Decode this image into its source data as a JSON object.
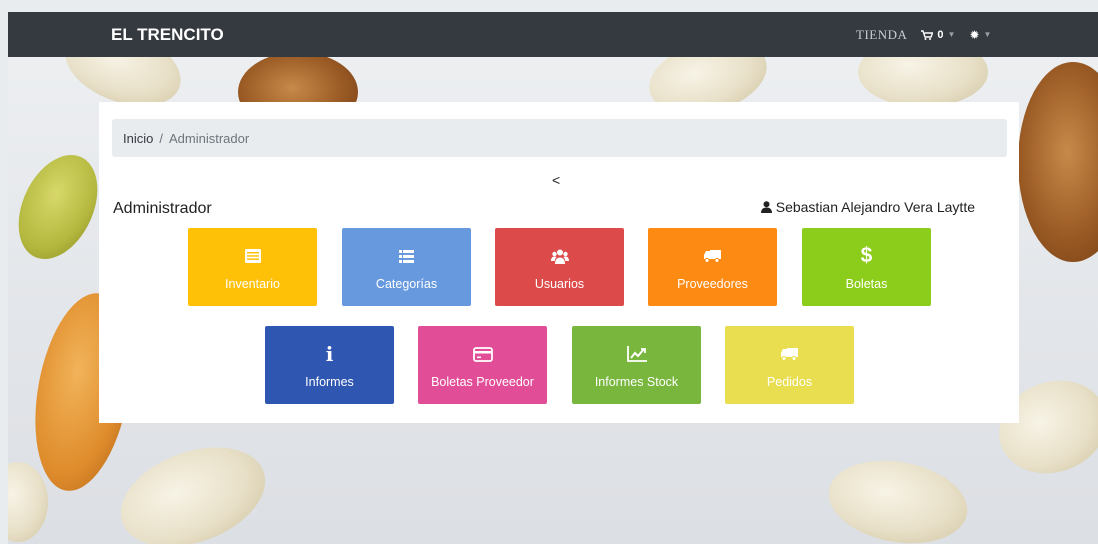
{
  "navbar": {
    "brand": "EL TRENCITO",
    "tienda": "TIENDA",
    "cart_count": "0"
  },
  "breadcrumb": {
    "home": "Inicio",
    "separator": "/",
    "current": "Administrador"
  },
  "back_symbol": "<",
  "page_title": "Administrador",
  "user_name": "Sebastian Alejandro Vera Laytte",
  "tiles": [
    {
      "label": "Inventario",
      "icon": "list-alt-icon",
      "color": "#ffc107"
    },
    {
      "label": "Categorías",
      "icon": "list-icon",
      "color": "#6699dd"
    },
    {
      "label": "Usuarios",
      "icon": "users-icon",
      "color": "#dc4a4a"
    },
    {
      "label": "Proveedores",
      "icon": "truck-icon",
      "color": "#fd8a12"
    },
    {
      "label": "Boletas",
      "icon": "dollar-icon",
      "color": "#8ccc1a"
    },
    {
      "label": "Informes",
      "icon": "info-icon",
      "color": "#2f56b0"
    },
    {
      "label": "Boletas Proveedor",
      "icon": "credit-card-icon",
      "color": "#e24d97"
    },
    {
      "label": "Informes Stock",
      "icon": "line-chart-icon",
      "color": "#79b63e"
    },
    {
      "label": "Pedidos",
      "icon": "truck-icon",
      "color": "#e9de50"
    }
  ]
}
